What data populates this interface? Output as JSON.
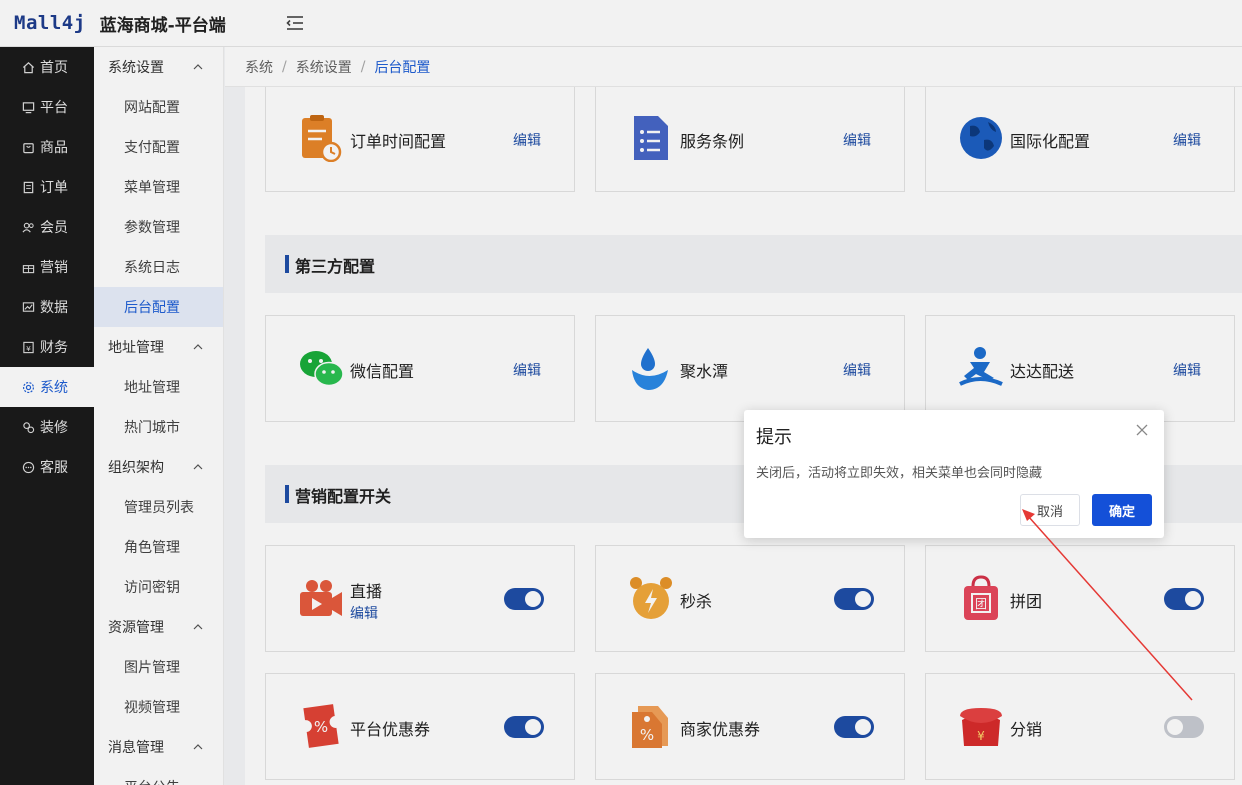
{
  "header": {
    "logo": "Mall4j",
    "title": "蓝海商城-平台端"
  },
  "nav1": [
    {
      "label": "首页",
      "icon": "home-icon"
    },
    {
      "label": "平台",
      "icon": "monitor-icon"
    },
    {
      "label": "商品",
      "icon": "bag-icon"
    },
    {
      "label": "订单",
      "icon": "order-icon"
    },
    {
      "label": "会员",
      "icon": "users-icon"
    },
    {
      "label": "营销",
      "icon": "gift-icon"
    },
    {
      "label": "数据",
      "icon": "chart-icon"
    },
    {
      "label": "财务",
      "icon": "finance-icon"
    },
    {
      "label": "系统",
      "icon": "gear-icon"
    },
    {
      "label": "装修",
      "icon": "decorate-icon"
    },
    {
      "label": "客服",
      "icon": "chat-icon"
    }
  ],
  "nav2": [
    {
      "type": "group",
      "label": "系统设置"
    },
    {
      "type": "item",
      "label": "网站配置"
    },
    {
      "type": "item",
      "label": "支付配置"
    },
    {
      "type": "item",
      "label": "菜单管理"
    },
    {
      "type": "item",
      "label": "参数管理"
    },
    {
      "type": "item",
      "label": "系统日志"
    },
    {
      "type": "item",
      "label": "后台配置"
    },
    {
      "type": "group",
      "label": "地址管理"
    },
    {
      "type": "item",
      "label": "地址管理"
    },
    {
      "type": "item",
      "label": "热门城市"
    },
    {
      "type": "group",
      "label": "组织架构"
    },
    {
      "type": "item",
      "label": "管理员列表"
    },
    {
      "type": "item",
      "label": "角色管理"
    },
    {
      "type": "item",
      "label": "访问密钥"
    },
    {
      "type": "group",
      "label": "资源管理"
    },
    {
      "type": "item",
      "label": "图片管理"
    },
    {
      "type": "item",
      "label": "视频管理"
    },
    {
      "type": "group",
      "label": "消息管理"
    },
    {
      "type": "item",
      "label": "平台公告"
    }
  ],
  "breadcrumb": {
    "a": "系统",
    "b": "系统设置",
    "c": "后台配置",
    "sep": "/"
  },
  "edit_label": "编辑",
  "row1": [
    {
      "title": "订单时间配置",
      "icon": "order-time-icon"
    },
    {
      "title": "服务条例",
      "icon": "document-icon"
    },
    {
      "title": "国际化配置",
      "icon": "globe-icon"
    }
  ],
  "section_third_party": "第三方配置",
  "row2": [
    {
      "title": "微信配置",
      "icon": "wechat-icon"
    },
    {
      "title": "聚水潭",
      "icon": "water-drop-icon"
    },
    {
      "title": "达达配送",
      "icon": "delivery-icon"
    }
  ],
  "section_marketing": "营销配置开关",
  "row3": [
    {
      "title": "直播",
      "sub": "编辑",
      "icon": "live-camera-icon",
      "enabled": true
    },
    {
      "title": "秒杀",
      "icon": "alarm-clock-icon",
      "enabled": true
    },
    {
      "title": "拼团",
      "icon": "group-buy-icon",
      "enabled": true
    }
  ],
  "row4": [
    {
      "title": "平台优惠券",
      "icon": "coupon-icon",
      "enabled": true
    },
    {
      "title": "商家优惠券",
      "icon": "tag-icon",
      "enabled": true
    },
    {
      "title": "分销",
      "icon": "red-packet-icon",
      "enabled": false
    }
  ],
  "dialog": {
    "title": "提示",
    "message": "关闭后，活动将立即失效，相关菜单也会同时隐藏",
    "cancel": "取消",
    "confirm": "确定"
  },
  "colors": {
    "accent": "#1f4fa8",
    "primary_button": "#1450d8",
    "annotation_arrow": "#e53935"
  }
}
